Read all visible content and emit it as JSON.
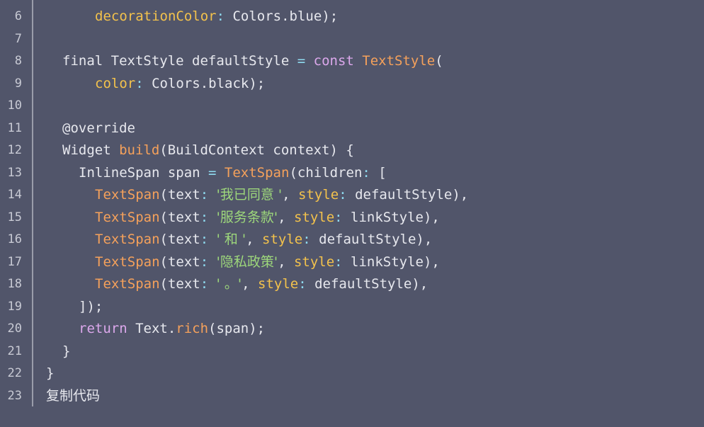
{
  "editor": {
    "lines": [
      {
        "num": "6",
        "tokens": [
          {
            "t": "decorationColor",
            "c": "prop"
          },
          {
            "t": ": ",
            "c": "op"
          },
          {
            "t": "Colors.blue);",
            "c": "plain"
          }
        ],
        "indent": "i6"
      },
      {
        "num": "7",
        "tokens": [],
        "indent": ""
      },
      {
        "num": "8",
        "tokens": [
          {
            "t": "final ",
            "c": "plain"
          },
          {
            "t": "TextStyle defaultStyle ",
            "c": "plain"
          },
          {
            "t": "= ",
            "c": "op"
          },
          {
            "t": "const ",
            "c": "kw"
          },
          {
            "t": "TextStyle",
            "c": "fn"
          },
          {
            "t": "(",
            "c": "plain"
          }
        ],
        "indent": "i2"
      },
      {
        "num": "9",
        "tokens": [
          {
            "t": "color",
            "c": "prop"
          },
          {
            "t": ": ",
            "c": "op"
          },
          {
            "t": "Colors.black);",
            "c": "plain"
          }
        ],
        "indent": "i6"
      },
      {
        "num": "10",
        "tokens": [],
        "indent": ""
      },
      {
        "num": "11",
        "tokens": [
          {
            "t": "@override",
            "c": "plain"
          }
        ],
        "indent": "i2"
      },
      {
        "num": "12",
        "tokens": [
          {
            "t": "Widget ",
            "c": "plain"
          },
          {
            "t": "build",
            "c": "fn"
          },
          {
            "t": "(BuildContext context) {",
            "c": "plain"
          }
        ],
        "indent": "i2"
      },
      {
        "num": "13",
        "tokens": [
          {
            "t": "InlineSpan span ",
            "c": "plain"
          },
          {
            "t": "= ",
            "c": "op"
          },
          {
            "t": "TextSpan",
            "c": "fn"
          },
          {
            "t": "(children",
            "c": "plain"
          },
          {
            "t": ": ",
            "c": "op"
          },
          {
            "t": "[",
            "c": "plain"
          }
        ],
        "indent": "i4"
      },
      {
        "num": "14",
        "tokens": [
          {
            "t": "TextSpan",
            "c": "fn"
          },
          {
            "t": "(text",
            "c": "plain"
          },
          {
            "t": ": ",
            "c": "op"
          },
          {
            "t": "'我已同意 '",
            "c": "str"
          },
          {
            "t": ", ",
            "c": "plain"
          },
          {
            "t": "style",
            "c": "prop"
          },
          {
            "t": ": ",
            "c": "op"
          },
          {
            "t": "defaultStyle),",
            "c": "plain"
          }
        ],
        "indent": "i6"
      },
      {
        "num": "15",
        "tokens": [
          {
            "t": "TextSpan",
            "c": "fn"
          },
          {
            "t": "(text",
            "c": "plain"
          },
          {
            "t": ": ",
            "c": "op"
          },
          {
            "t": "'服务条款'",
            "c": "str"
          },
          {
            "t": ", ",
            "c": "plain"
          },
          {
            "t": "style",
            "c": "prop"
          },
          {
            "t": ": ",
            "c": "op"
          },
          {
            "t": "linkStyle),",
            "c": "plain"
          }
        ],
        "indent": "i6"
      },
      {
        "num": "16",
        "tokens": [
          {
            "t": "TextSpan",
            "c": "fn"
          },
          {
            "t": "(text",
            "c": "plain"
          },
          {
            "t": ": ",
            "c": "op"
          },
          {
            "t": "' 和 '",
            "c": "str"
          },
          {
            "t": ", ",
            "c": "plain"
          },
          {
            "t": "style",
            "c": "prop"
          },
          {
            "t": ": ",
            "c": "op"
          },
          {
            "t": "defaultStyle),",
            "c": "plain"
          }
        ],
        "indent": "i6"
      },
      {
        "num": "17",
        "tokens": [
          {
            "t": "TextSpan",
            "c": "fn"
          },
          {
            "t": "(text",
            "c": "plain"
          },
          {
            "t": ": ",
            "c": "op"
          },
          {
            "t": "'隐私政策'",
            "c": "str"
          },
          {
            "t": ", ",
            "c": "plain"
          },
          {
            "t": "style",
            "c": "prop"
          },
          {
            "t": ": ",
            "c": "op"
          },
          {
            "t": "linkStyle),",
            "c": "plain"
          }
        ],
        "indent": "i6"
      },
      {
        "num": "18",
        "tokens": [
          {
            "t": "TextSpan",
            "c": "fn"
          },
          {
            "t": "(text",
            "c": "plain"
          },
          {
            "t": ": ",
            "c": "op"
          },
          {
            "t": "' 。'",
            "c": "str"
          },
          {
            "t": ", ",
            "c": "plain"
          },
          {
            "t": "style",
            "c": "prop"
          },
          {
            "t": ": ",
            "c": "op"
          },
          {
            "t": "defaultStyle),",
            "c": "plain"
          }
        ],
        "indent": "i6"
      },
      {
        "num": "19",
        "tokens": [
          {
            "t": "]);",
            "c": "plain"
          }
        ],
        "indent": "i4"
      },
      {
        "num": "20",
        "tokens": [
          {
            "t": "return ",
            "c": "kw"
          },
          {
            "t": "Text.",
            "c": "plain"
          },
          {
            "t": "rich",
            "c": "fn"
          },
          {
            "t": "(span);",
            "c": "plain"
          }
        ],
        "indent": "i4"
      },
      {
        "num": "21",
        "tokens": [
          {
            "t": "}",
            "c": "plain"
          }
        ],
        "indent": "i2"
      },
      {
        "num": "22",
        "tokens": [
          {
            "t": "}",
            "c": "plain"
          }
        ],
        "indent": ""
      },
      {
        "num": "23",
        "tokens": [
          {
            "t": "复制代码",
            "c": "plain"
          }
        ],
        "indent": ""
      }
    ]
  },
  "colors": {
    "background": "#51556a",
    "keyword": "#dca8ec",
    "function": "#f5a15b",
    "property": "#f3c24c",
    "operator": "#8fdbf0",
    "string": "#9dd77b",
    "text": "#e7e8ee"
  }
}
